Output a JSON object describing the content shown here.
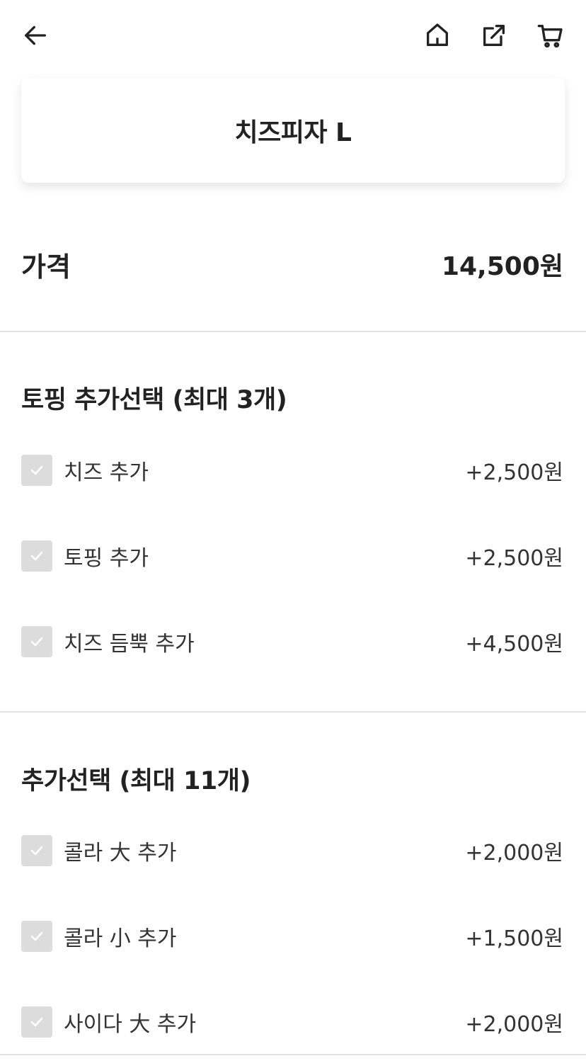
{
  "product": {
    "name": "치즈피자 L"
  },
  "price": {
    "label": "가격",
    "value": "14,500원"
  },
  "sections": [
    {
      "title": "토핑 추가선택 (최대 3개)",
      "options": [
        {
          "label": "치즈 추가",
          "price": "+2,500원"
        },
        {
          "label": "토핑 추가",
          "price": "+2,500원"
        },
        {
          "label": "치즈 듬뿍 추가",
          "price": "+4,500원"
        }
      ]
    },
    {
      "title": "추가선택 (최대 11개)",
      "options": [
        {
          "label": "콜라 大 추가",
          "price": "+2,000원"
        },
        {
          "label": "콜라 小 추가",
          "price": "+1,500원"
        },
        {
          "label": "사이다 大 추가",
          "price": "+2,000원"
        }
      ]
    }
  ],
  "icons": {
    "back": "arrow-left-icon",
    "home": "home-icon",
    "share": "share-icon",
    "cart": "cart-icon",
    "check": "check-icon"
  },
  "colors": {
    "text": "#222222",
    "checkbox_bg": "#dcdcdc",
    "divider": "#e2e2e2"
  }
}
